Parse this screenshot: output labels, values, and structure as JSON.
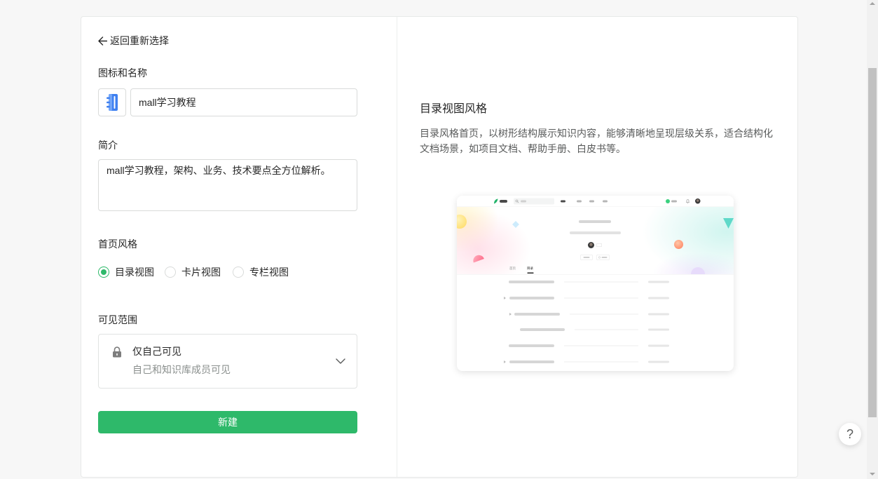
{
  "colors": {
    "accent": "#2eb96a",
    "text_primary": "#262626",
    "text_secondary": "#8a8f8d",
    "border": "#d9dbda"
  },
  "form": {
    "back": {
      "icon": "arrow-left-icon",
      "label": "返回重新选择"
    },
    "icon_and_name": {
      "label": "图标和名称",
      "icon": "book-icon",
      "name_value": "mall学习教程"
    },
    "intro": {
      "label": "简介",
      "value": "mall学习教程，架构、业务、技术要点全方位解析。"
    },
    "home_style": {
      "label": "首页风格",
      "options": [
        {
          "label": "目录视图",
          "checked": true
        },
        {
          "label": "卡片视图",
          "checked": false
        },
        {
          "label": "专栏视图",
          "checked": false
        }
      ]
    },
    "visibility": {
      "label": "可见范围",
      "icon": "lock-icon",
      "selected_title": "仅自己可见",
      "selected_description": "自己和知识库成员可见",
      "dropdown_icon": "chevron-down-icon"
    },
    "submit_label": "新建"
  },
  "preview": {
    "title": "目录视图风格",
    "description": "目录风格首页，以树形结构展示知识内容，能够清晰地呈现层级关系，适合结构化文档场景，如项目文档、帮助手册、白皮书等。",
    "mock_tabs": [
      "首页",
      "目录"
    ],
    "mock_active_tab": 1
  },
  "help_button": {
    "label": "?"
  }
}
